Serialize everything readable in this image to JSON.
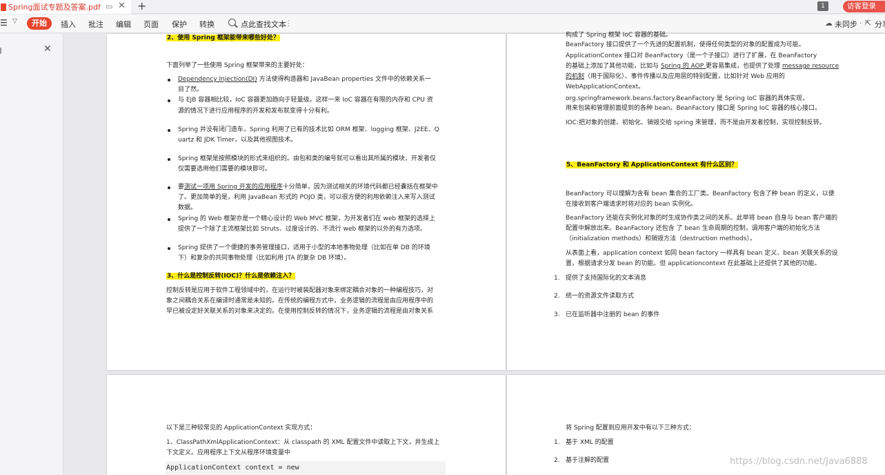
{
  "tabbar": {
    "file_tab": "Spring面试专题及答案.pdf",
    "pin_glyph": "▭",
    "close_glyph": "✕",
    "add_glyph": "+",
    "page_badge": "1",
    "guest_login": "访客登录"
  },
  "toolbar": {
    "start": "开始",
    "insert": "插入",
    "annotate": "批注",
    "edit": "编辑",
    "page": "页面",
    "protect": "保护",
    "convert": "转换",
    "find": "点此查找文本",
    "sync": "未同步",
    "share": "分享"
  },
  "colors": {
    "accent": "#e8452c",
    "highlight": "#ffef16"
  },
  "page1": {
    "h2": "2、使用 Spring 框架能带来哪些好处？",
    "intro": "下面列举了一些使用 Spring 框架带来的主要好处：",
    "b1_link": "Dependency Injection(DI)",
    "b1_a": " 方法使得构造器和 JavaBean properties 文件中的依赖关系一",
    "b1_b": "目了然。",
    "b2_a": "与 EJB 容器相比较，IoC 容器更加趋向于轻量级。这样一来 IoC 容器在有限的内存和 CPU 资",
    "b2_b": "源的情况下进行应用程序的开发和发布就变得十分有利。",
    "b3_a": "Spring 并没有闭门造车，Spring 利用了已有的技术比如 ORM 框架、logging 框架、J2EE、Q",
    "b3_b": "uartz 和 JDK Timer，以及其他视图技术。",
    "b4_a": "Spring 框架是按照模块的形式来组织的。由包和类的编号就可以看出其所属的模块，开发者仅",
    "b4_b": "仅需要选用他们需要的模块即可。",
    "b5_pre": "要",
    "b5_link": "测试一项用 Spring 开发的应用程序",
    "b5_post": "十分简单，因为测试相关的环境代码都已经囊括在框架中",
    "b5_b": "了。更加简单的是，利用 JavaBean 形式的 POJO 类，可以很方便的利用依赖注入来写入测试",
    "b5_c": "数据。",
    "b6_a": "Spring 的 Web 框架亦是一个精心设计的 Web MVC 框架，为开发者们在 web 框架的选择上",
    "b6_b": "提供了一个除了主流框架比如 Struts、过度设计的、不流行 web 框架的以外的有力选项。",
    "b7_a": "Spring 提供了一个便捷的事务管理接口，适用于小型的本地事物处理（比如在单 DB 的环境",
    "b7_b": "下）和复杂的共同事物处理（比如利用 JTA 的复杂 DB 环境）。",
    "h3": "3、什么是控制反转(IOC)？什么是依赖注入？",
    "p3_a": "控制反转是应用于软件工程领域中的，在运行时被装配器对象来绑定耦合对象的一种编程技巧，对",
    "p3_b": "象之间耦合关系在编译时通常是未知的。在传统的编程方式中，业务逻辑的流程是由应用程序中的",
    "p3_c": "早已被设定好关联关系的对象来决定的。在使用控制反转的情况下，业务逻辑的流程是由对象关系"
  },
  "page2": {
    "t0": "构成了 Spring 框架 IoC 容器的基础。",
    "t1": "BeanFactory 接口提供了一个先进的配置机制，使得任何类型的对象的配置成为可能。",
    "t2": "ApplicationContex 接口对 BeanFactory（是一个子接口）进行了扩展，在 BeanFactory",
    "t3_pre": "的基础上添加了其他功能，比如与 ",
    "t3_link1": "Spring 的 AOP ",
    "t3_mid": "更容易集成，也提供了处理 ",
    "t3_link2": "message resource",
    "t4_link": "的机制",
    "t4_post": "（用于国际化）、事件传播以及应用层的特别配置，比如针对 Web 应用的",
    "t5": "WebApplicationContext。",
    "t6": "org.springframework.beans.factory.BeanFactory 是 Spring IoC 容器的具体实现，",
    "t7": "用来包装和管理前面提到的各种 bean。BeanFactory 接口是 Spring IoC 容器的核心接口。",
    "t8": "IOC:把对象的创建、初始化、销毁交给 spring 来管理，而不是由开发者控制，实现控制反转。",
    "h5": "5、BeanFactory 和 ApplicationContext 有什么区别？",
    "p5a": "BeanFactory 可以理解为含有 bean 集合的工厂类。BeanFactory 包含了种 bean 的定义，以便",
    "p5b": "在接收到客户端请求时将对应的 bean 实例化。",
    "p5c": "BeanFactory 还能在实例化对象的时生成协作类之间的关系。此举将 bean 自身与 bean 客户端的",
    "p5d": "配置中解放出来。BeanFactory 还包含 了 bean 生命周期的控制，调用客户端的初始化方法",
    "p5e": "（initialization methods）和销毁方法（destruction methods）。",
    "p5f": "从表面上看，application context 如同 bean factory 一样具有 bean 定义、bean 关联关系的设",
    "p5g": "置，根据请求分发 bean 的功能。但 applicationcontext 在此基础上还提供了其他的功能。",
    "n1": "1.",
    "n1t": "提供了支持国际化的文本消息",
    "n2": "2.",
    "n2t": "统一的资源文件读取方式",
    "n3": "3.",
    "n3t": "已在监听器中注册的 bean 的事件"
  },
  "page3": {
    "l1": "以下是三种较常见的 ApplicationContext 实现方式：",
    "l2": "1、ClassPathXmlApplicationContext：从 classpath 的 XML 配置文件中读取上下文，并生成上",
    "l3": "下文定义。应用程序上下文从程序环境变量中",
    "code": "ApplicationContext context = new"
  },
  "page4": {
    "l1": "将 Spring 配置到应用开发中有以下三种方式：",
    "n1": "1.",
    "n1t": "基于 XML 的配置",
    "n2": "2.",
    "n2t": "基于注解的配置"
  },
  "watermark": "https://blog.csdn.net/Java6888"
}
